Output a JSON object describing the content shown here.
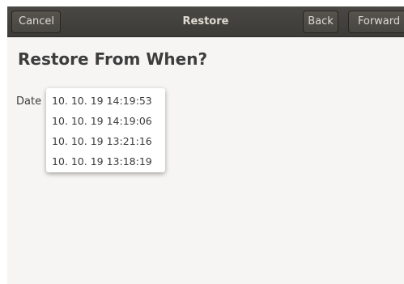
{
  "header": {
    "cancel_label": "Cancel",
    "title": "Restore",
    "back_label": "Back",
    "forward_label": "Forward"
  },
  "main": {
    "heading": "Restore From When?",
    "date_label": "Date",
    "date_options": [
      "10. 10. 19 14:19:53",
      "10. 10. 19 14:19:06",
      "10. 10. 19 13:21:16",
      "10. 10. 19 13:18:19"
    ]
  },
  "colors": {
    "headerbar": "#3c3b37",
    "background": "#f6f5f4",
    "text": "#3c3c3c"
  }
}
